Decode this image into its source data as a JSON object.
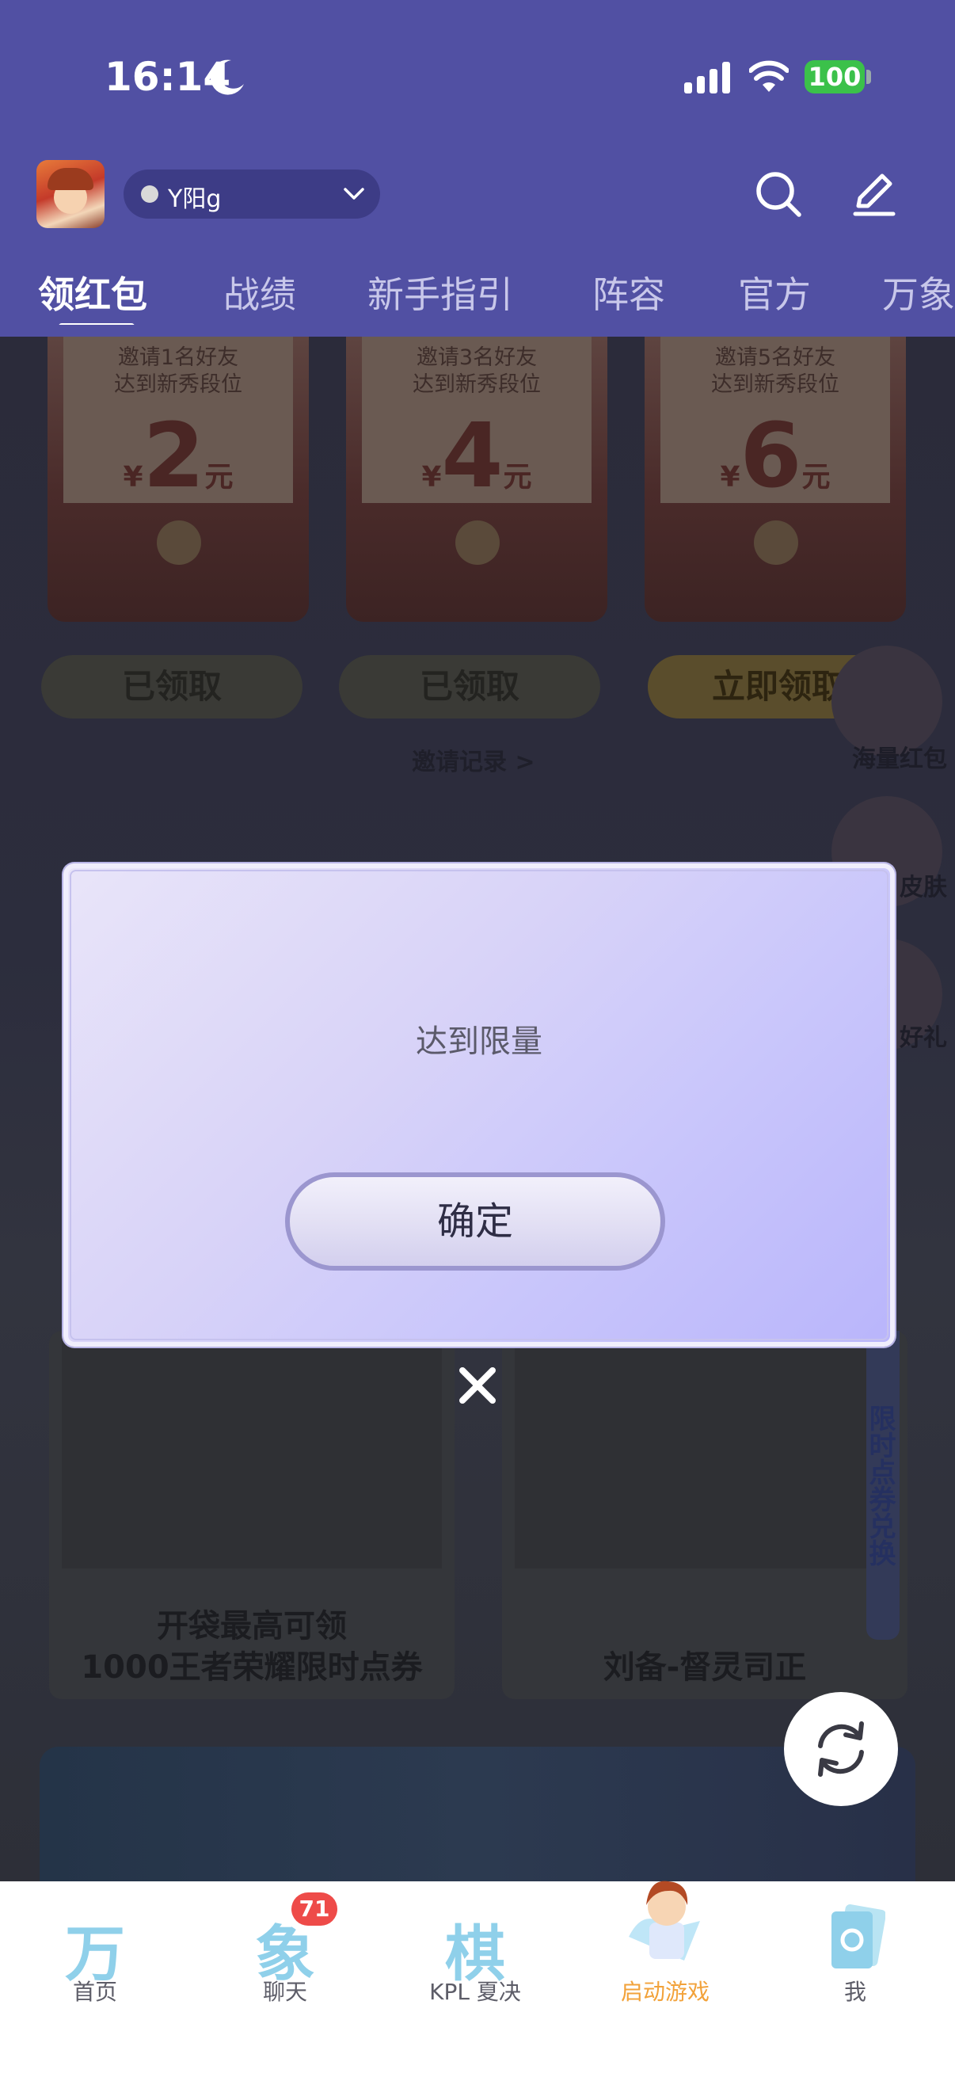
{
  "status_bar": {
    "time": "16:14",
    "battery": "100"
  },
  "header": {
    "account_name": "Y阳g",
    "tabs": [
      {
        "label": "领红包"
      },
      {
        "label": "战绩"
      },
      {
        "label": "新手指引"
      },
      {
        "label": "阵容"
      },
      {
        "label": "官方"
      },
      {
        "label": "万象"
      }
    ]
  },
  "background": {
    "redpacks": [
      {
        "invite_line1": "邀请1名好友",
        "invite_line2": "达到新秀段位",
        "currency": "¥",
        "amount": "2",
        "unit": "元",
        "button": "已领取"
      },
      {
        "invite_line1": "邀请3名好友",
        "invite_line2": "达到新秀段位",
        "currency": "¥",
        "amount": "4",
        "unit": "元",
        "button": "已领取"
      },
      {
        "invite_line1": "邀请5名好友",
        "invite_line2": "达到新秀段位",
        "currency": "¥",
        "amount": "6",
        "unit": "元",
        "button": "立即领取"
      }
    ],
    "invite_record": "邀请记录 >",
    "side_floats": [
      {
        "label": "海量红包"
      },
      {
        "label": "皮肤"
      },
      {
        "label": "好礼"
      }
    ],
    "cards": [
      {
        "line1": "开袋最高可领",
        "line2": "1000王者荣耀限时点券"
      },
      {
        "line1": "刘备-督灵司正"
      }
    ],
    "card_side_tag": "限时点券兑换"
  },
  "modal": {
    "message": "达到限量",
    "confirm_label": "确定"
  },
  "bottom_nav": {
    "items": [
      {
        "glyph": "万",
        "label": "首页"
      },
      {
        "glyph": "象",
        "label": "聊天",
        "badge": "71"
      },
      {
        "glyph": "棋",
        "label": "KPL 夏决"
      },
      {
        "label": "启动游戏"
      },
      {
        "label": "我"
      }
    ]
  },
  "colors": {
    "header_bg": "#5150a3",
    "accent_orange": "#f2a23a",
    "badge_red": "#ee4b49"
  }
}
